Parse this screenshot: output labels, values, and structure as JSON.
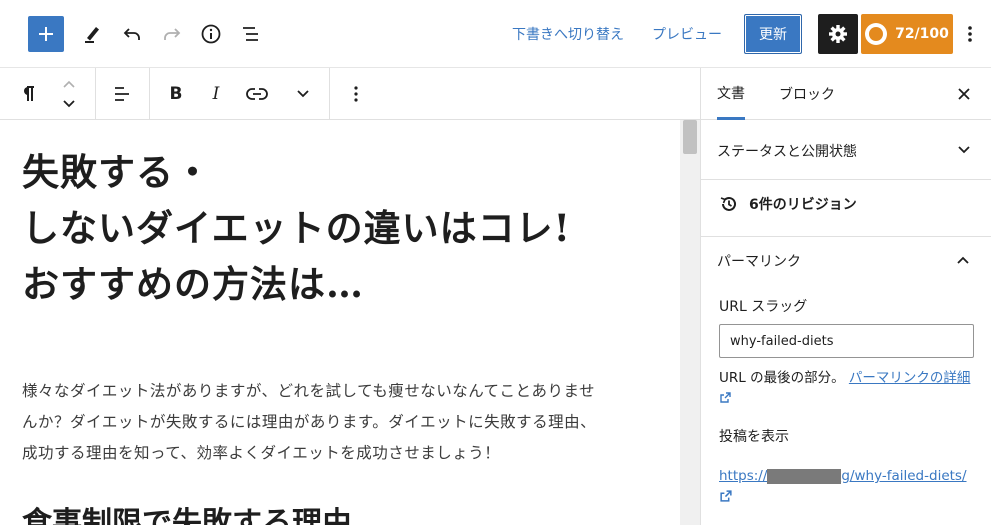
{
  "header": {
    "switch_to_draft": "下書きへ切り替え",
    "preview": "プレビュー",
    "update": "更新",
    "score": "72/100",
    "icons": [
      "plus-icon",
      "pencil-icon",
      "undo-icon",
      "redo-icon",
      "info-icon",
      "list-view-icon",
      "gear-icon",
      "score-icon",
      "more-vertical-icon"
    ]
  },
  "block_toolbar": {
    "icons": [
      "paragraph-icon",
      "move-up-icon",
      "move-down-icon",
      "align-icon",
      "bold-icon",
      "italic-icon",
      "link-icon",
      "chevron-down-icon",
      "more-vertical-icon"
    ]
  },
  "editor": {
    "title_lines": [
      "失敗する・",
      "しないダイエットの違いはコレ!",
      "おすすめの方法は…"
    ],
    "paragraph_lines": [
      "様々なダイエット法がありますが、どれを試しても痩せないなんてことありませ",
      "んか？ダイエットが失敗するには理由があります。ダイエットに失敗する理由、",
      "成功する理由を知って、効率よくダイエットを成功させましょう！"
    ],
    "heading2": "食事制限で失敗する理由"
  },
  "sidebar": {
    "tabs": [
      "文書",
      "ブロック"
    ],
    "active_tab": "文書",
    "status_panel": "ステータスと公開状態",
    "revisions": "6件のリビジョン",
    "permalink_panel": "パーマリンク",
    "slug_label": "URL スラッグ",
    "slug_value": "why-failed-diets",
    "help_prefix": "URL の最後の部分。",
    "help_link": "パーマリンクの詳細",
    "view_post_label": "投稿を表示",
    "post_url_prefix": "https://",
    "post_url_suffix": "g/why-failed-diets/"
  },
  "colors": {
    "accent": "#3a78c2",
    "score_badge": "#e48a1e",
    "dark_button": "#1e1e1e"
  }
}
